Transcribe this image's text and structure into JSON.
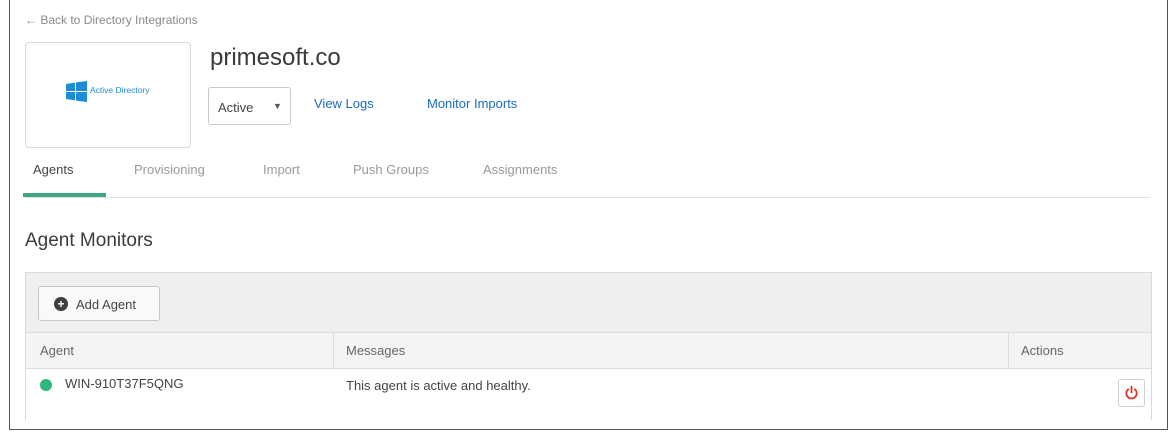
{
  "nav": {
    "back_label": "← Back to Directory Integrations"
  },
  "app": {
    "logo_text": "Active Directory",
    "title": "primesoft.co",
    "status_value": "Active",
    "links": [
      "View Logs",
      "Monitor Imports"
    ]
  },
  "tabs": [
    {
      "label": "Agents",
      "active": true
    },
    {
      "label": "Provisioning",
      "active": false
    },
    {
      "label": "Import",
      "active": false
    },
    {
      "label": "Push Groups",
      "active": false
    },
    {
      "label": "Assignments",
      "active": false
    }
  ],
  "section": {
    "title": "Agent Monitors"
  },
  "toolbar": {
    "add_label": "Add Agent"
  },
  "table": {
    "headers": [
      "Agent",
      "Messages",
      "Actions"
    ],
    "rows": [
      {
        "agent": "WIN-910T37F5QNG",
        "message": "This agent is active and healthy.",
        "status": "healthy"
      }
    ]
  },
  "colors": {
    "accent_tab": "#3da982",
    "status_healthy": "#2fb67a",
    "link": "#1a6cbf",
    "power": "#e0332d",
    "logo_blue": "#1e8bd6"
  },
  "icons": {
    "logo": "windows-logo-icon",
    "add": "plus-circle-icon",
    "status": "status-dot-icon",
    "action": "power-icon",
    "dropdown": "caret-down-icon"
  }
}
